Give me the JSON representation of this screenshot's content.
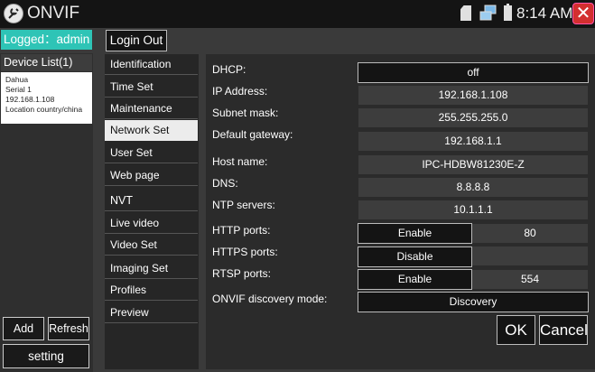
{
  "titlebar": {
    "app_name": "ONVIF",
    "time": "8:14 AM",
    "close_glyph": "✕",
    "icons": [
      "onvif-app-icon",
      "sd-card-icon",
      "network-icon",
      "battery-icon",
      "close-icon"
    ]
  },
  "session": {
    "logged": "Logged：admin",
    "login_out": "Login Out"
  },
  "devices": {
    "title": "Device List(1)",
    "items": [
      {
        "name": "Dahua",
        "serial": "Serial  1",
        "ip": "192.168.1.108",
        "location": "Location  country/china"
      }
    ]
  },
  "left_buttons": {
    "add": "Add",
    "refresh": "Refresh",
    "setting": "setting"
  },
  "menu": {
    "items": [
      "Identification",
      "Time Set",
      "Maintenance",
      "Network Set",
      "User Set",
      "Web page"
    ],
    "active": "Network Set",
    "nvt_title": "NVT",
    "nvt_items": [
      "Live video",
      "Video Set",
      "Imaging Set",
      "Profiles",
      "Preview"
    ]
  },
  "network": {
    "dhcp_label": "DHCP:",
    "dhcp_value": "off",
    "ip_label": "IP Address:",
    "ip_value": "192.168.1.108",
    "mask_label": "Subnet mask:",
    "mask_value": "255.255.255.0",
    "gateway_label": "Default gateway:",
    "gateway_value": "192.168.1.1",
    "host_label": "Host name:",
    "host_value": "IPC-HDBW81230E-Z",
    "dns_label": "DNS:",
    "dns_value": "8.8.8.8",
    "ntp_label": "NTP servers:",
    "ntp_value": "10.1.1.1",
    "http_label": "HTTP ports:",
    "http_state": "Enable",
    "http_port": "80",
    "https_label": "HTTPS ports:",
    "https_state": "Disable",
    "rtsp_label": "RTSP ports:",
    "rtsp_state": "Enable",
    "rtsp_port": "554",
    "discovery_label": "ONVIF discovery mode:",
    "discovery_value": "Discovery"
  },
  "actions": {
    "ok": "OK",
    "cancel": "Cancel"
  }
}
